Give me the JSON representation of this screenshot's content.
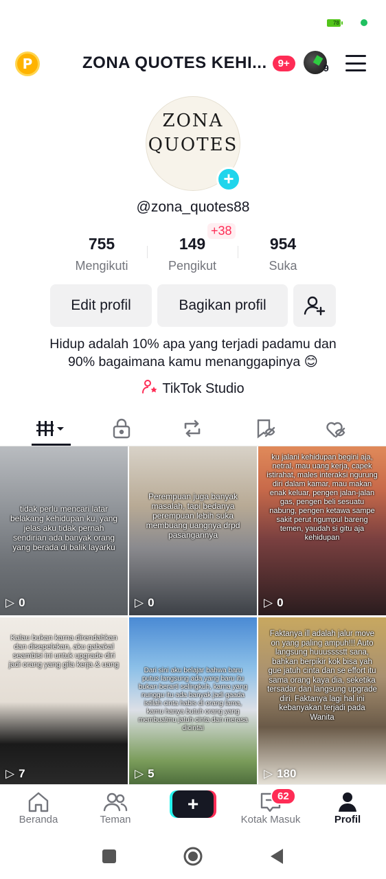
{
  "status_bar": {
    "battery": "78"
  },
  "header": {
    "title": "ZONA QUOTES KEHI...",
    "notification_badge": "9+",
    "account_count": "9"
  },
  "profile": {
    "photo_text_line1": "ZONA",
    "photo_text_line2": "QUOTES",
    "username": "@zona_quotes88",
    "stats": {
      "following": {
        "value": "755",
        "label": "Mengikuti"
      },
      "followers": {
        "value": "149",
        "label": "Pengikut",
        "new": "+38"
      },
      "likes": {
        "value": "954",
        "label": "Suka"
      }
    },
    "buttons": {
      "edit": "Edit profil",
      "share": "Bagikan profil"
    },
    "bio_line1": "Hidup adalah 10% apa yang terjadi padamu dan",
    "bio_line2": "90% bagaimana kamu menanggapinya 😊",
    "studio": "TikTok Studio"
  },
  "videos": [
    {
      "caption": "tidak perlu mencari latar belakang kehidupan ku, yang jelas aku tidak pernah sendirian ada banyak orang yang berada di balik layarku",
      "views": "0"
    },
    {
      "caption": "Perempuan juga banyak masalah, tapi bedanya perempuan lebih suka membuang uangnya drpd pasangannya",
      "views": "0"
    },
    {
      "caption": "ku jalani kehidupan begini aja, netral, mau uang kerja, capek istirahat, males interaksi ngurung diri dalam kamar, mau makan enak keluar, pengen jalan-jalan gas, pengen beli sesuatu nabung, pengen ketawa sampe sakit perut ngumpul bareng temen, yaudah si gitu aja kehidupan",
      "views": "0"
    },
    {
      "caption": "Kalau bukan karna direndahkan dan disepelekan, aku gabakal seambisi ini untuk upgrade diri jadi orang yang gila kerja & uang",
      "views": "7"
    },
    {
      "caption": "Dari sini aku belajar bahwa baru putus langsung ada yang baru itu bukan berarti selingkuh, karna yang nunggu itu ada banyak jadi gaada istilah cinta habis di orang lama, kamu hanya butuh orang yang membuatmu jatuh cinta dan merasa dicintai",
      "views": "5"
    },
    {
      "caption": "Faktanya ill adalah jalur move on yang paling ampuh!!! Auto langsung huuusssstt sana, bahkan berpikir kok bisa yah gue jatuh cinta dan se effort itu sama orang kaya dia, seketika tersadar dan langsung upgrade diri. Faktanya lagi hal ini kebanyakan terjadi pada Wanita",
      "views": "180"
    }
  ],
  "bottom_nav": {
    "home": "Beranda",
    "friends": "Teman",
    "inbox": "Kotak Masuk",
    "inbox_badge": "62",
    "profile": "Profil"
  }
}
